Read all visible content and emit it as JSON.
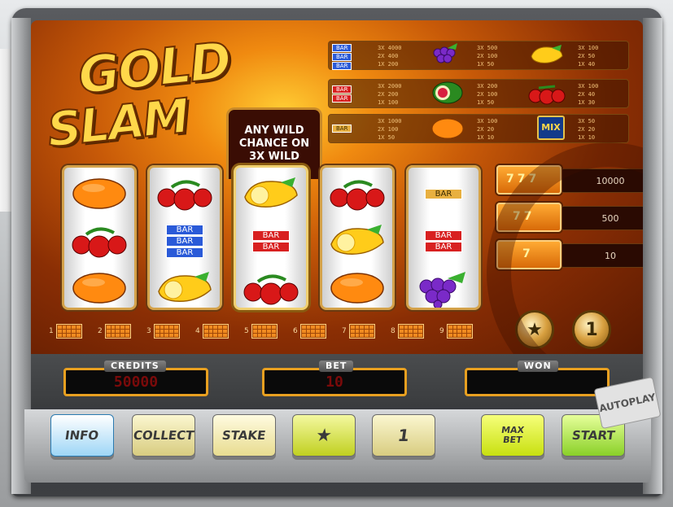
{
  "title": {
    "line1": "GOLD",
    "line2": "SLAM"
  },
  "wild_notice": {
    "line1": "ANY WILD",
    "line2": "CHANCE ON",
    "line3": "3X WILD"
  },
  "symbol_labels": {
    "bar": "BAR",
    "mix": "MIX"
  },
  "paytable": {
    "row1": {
      "blue_bar": [
        "3X 4000",
        "2X 400",
        "1X 200"
      ],
      "grapes": [
        "3X 500",
        "2X 100",
        "1X 50"
      ],
      "lemon": [
        "3X 100",
        "2X 50",
        "1X 40"
      ]
    },
    "row2": {
      "red_bar": [
        "3X 2000",
        "2X 200",
        "1X 100"
      ],
      "melon": [
        "3X 200",
        "2X 100",
        "1X 50"
      ],
      "cherries": [
        "3X 100",
        "2X 40",
        "1X 30"
      ]
    },
    "row3": {
      "gold_bar": [
        "3X 1000",
        "2X 100",
        "1X 50"
      ],
      "orange": [
        "3X 100",
        "2X 20",
        "1X 10"
      ],
      "mix": [
        "3X 50",
        "2X 20",
        "1X 10"
      ]
    }
  },
  "reels": [
    [
      "orange",
      "cherries",
      "orange"
    ],
    [
      "cherries",
      "bar3",
      "lemon"
    ],
    [
      "lemon",
      "bar2",
      "cherries"
    ],
    [
      "cherries",
      "lemon",
      "orange"
    ],
    [
      "bar1",
      "bar2",
      "grapes"
    ]
  ],
  "bonus": [
    {
      "symbol": "777",
      "value": "10000"
    },
    {
      "symbol": "77",
      "value": "500"
    },
    {
      "symbol": "7",
      "value": "10"
    }
  ],
  "paylines": [
    "1",
    "2",
    "3",
    "4",
    "5",
    "6",
    "7",
    "8",
    "9"
  ],
  "coins": {
    "star": "★",
    "one": "1"
  },
  "meters": {
    "credits_label": "CREDITS",
    "credits_value": "50000",
    "bet_label": "BET",
    "bet_value": "10",
    "won_label": "WON",
    "won_value": ""
  },
  "buttons": {
    "info": "INFO",
    "collect": "COLLECT",
    "stake": "STAKE",
    "star": "★",
    "one": "1",
    "max_bet_1": "MAX",
    "max_bet_2": "BET",
    "start": "START",
    "autoplay": "AUTOPLAY"
  },
  "colors": {
    "accent": "#e8a020",
    "info_btn": "#9ed6f6",
    "action_btn": "#d8ec3a",
    "start_btn": "#a8e040"
  }
}
